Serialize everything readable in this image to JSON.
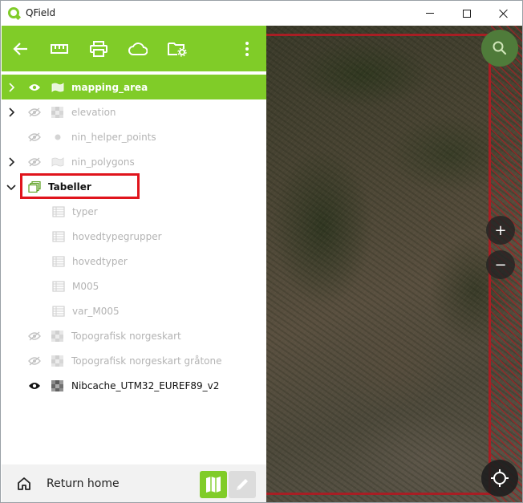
{
  "window": {
    "title": "QField",
    "controls": [
      "minimize",
      "maximize",
      "close"
    ]
  },
  "toolbar": {
    "buttons": [
      {
        "name": "back",
        "icon": "arrow-left-icon"
      },
      {
        "name": "measure",
        "icon": "ruler-icon"
      },
      {
        "name": "print",
        "icon": "printer-icon"
      },
      {
        "name": "cloud",
        "icon": "cloud-icon"
      },
      {
        "name": "project-folder",
        "icon": "folder-settings-icon"
      },
      {
        "name": "more",
        "icon": "kebab-menu-icon"
      }
    ]
  },
  "layers": [
    {
      "name": "mapping_area",
      "expandable": true,
      "expanded": false,
      "visible": true,
      "selected": true,
      "type": "polygon"
    },
    {
      "name": "elevation",
      "expandable": true,
      "expanded": false,
      "visible": false,
      "type": "raster"
    },
    {
      "name": "nin_helper_points",
      "expandable": false,
      "visible": false,
      "type": "point"
    },
    {
      "name": "nin_polygons",
      "expandable": true,
      "expanded": false,
      "visible": false,
      "type": "polygon",
      "highlighted": true
    },
    {
      "name": "Tabeller",
      "expandable": true,
      "expanded": true,
      "group": true,
      "type": "group"
    },
    {
      "name": "typer",
      "indent": true,
      "type": "table"
    },
    {
      "name": "hovedtypegrupper",
      "indent": true,
      "type": "table"
    },
    {
      "name": "hovedtyper",
      "indent": true,
      "type": "table"
    },
    {
      "name": "M005",
      "indent": true,
      "type": "table"
    },
    {
      "name": "var_M005",
      "indent": true,
      "type": "table"
    },
    {
      "name": "Topografisk norgeskart",
      "visible": false,
      "type": "raster"
    },
    {
      "name": "Topografisk norgeskart gråtone",
      "visible": false,
      "type": "raster"
    },
    {
      "name": "Nibcache_UTM32_EUREF89_v2",
      "visible": true,
      "type": "raster"
    }
  ],
  "bottombar": {
    "home_label": "Return home"
  },
  "map": {
    "zoom_in_label": "+",
    "zoom_out_label": "−"
  },
  "colors": {
    "accent": "#80cc28",
    "highlight": "#e0141c",
    "boundary": "#a81e24"
  }
}
